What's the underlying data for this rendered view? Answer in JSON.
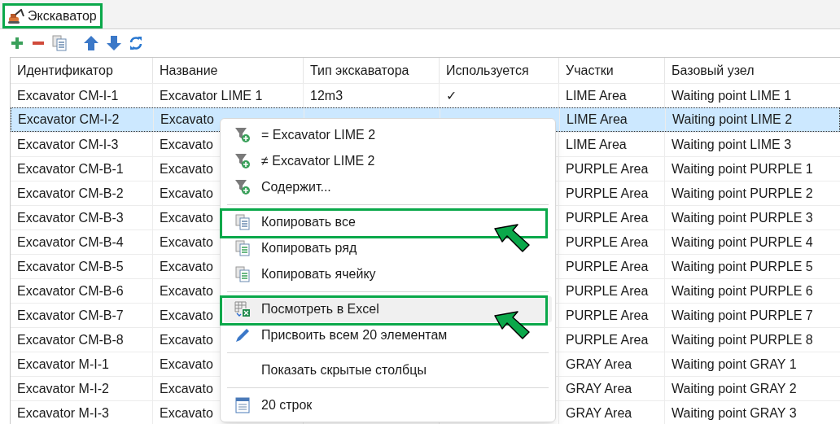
{
  "window": {
    "title": "Экскаватор",
    "title_highlighted": true
  },
  "table": {
    "columns": [
      "Идентификатор",
      "Название",
      "Тип экскаватора",
      "Используется",
      "Участки",
      "Базовый узел"
    ],
    "rows": [
      {
        "cells": [
          "Excavator CM-I-1",
          "Excavator LIME 1",
          "12m3",
          "✓",
          "LIME Area",
          "Waiting point LIME 1"
        ],
        "selected": false
      },
      {
        "cells": [
          "Excavator CM-I-2",
          "Excavato",
          null,
          null,
          "LIME Area",
          "Waiting point LIME 2"
        ],
        "selected": true
      },
      {
        "cells": [
          "Excavator CM-I-3",
          "Excavato",
          null,
          null,
          "LIME Area",
          "Waiting point LIME 3"
        ],
        "selected": false
      },
      {
        "cells": [
          "Excavator CM-B-1",
          "Excavato",
          null,
          null,
          "PURPLE Area",
          "Waiting point PURPLE 1"
        ],
        "selected": false
      },
      {
        "cells": [
          "Excavator CM-B-2",
          "Excavato",
          null,
          null,
          "PURPLE Area",
          "Waiting point PURPLE 2"
        ],
        "selected": false
      },
      {
        "cells": [
          "Excavator CM-B-3",
          "Excavato",
          null,
          null,
          "PURPLE Area",
          "Waiting point PURPLE 3"
        ],
        "selected": false
      },
      {
        "cells": [
          "Excavator CM-B-4",
          "Excavato",
          null,
          null,
          "PURPLE Area",
          "Waiting point PURPLE 4"
        ],
        "selected": false
      },
      {
        "cells": [
          "Excavator CM-B-5",
          "Excavato",
          null,
          null,
          "PURPLE Area",
          "Waiting point PURPLE 5"
        ],
        "selected": false
      },
      {
        "cells": [
          "Excavator CM-B-6",
          "Excavato",
          null,
          null,
          "PURPLE Area",
          "Waiting point PURPLE 6"
        ],
        "selected": false
      },
      {
        "cells": [
          "Excavator CM-B-7",
          "Excavato",
          null,
          null,
          "PURPLE Area",
          "Waiting point PURPLE 7"
        ],
        "selected": false
      },
      {
        "cells": [
          "Excavator CM-B-8",
          "Excavato",
          null,
          null,
          "PURPLE Area",
          "Waiting point PURPLE 8"
        ],
        "selected": false
      },
      {
        "cells": [
          "Excavator M-I-1",
          "Excavato",
          null,
          null,
          "GRAY Area",
          "Waiting point GRAY 1"
        ],
        "selected": false
      },
      {
        "cells": [
          "Excavator M-I-2",
          "Excavato",
          null,
          null,
          "GRAY Area",
          "Waiting point GRAY 2"
        ],
        "selected": false
      },
      {
        "cells": [
          "Excavator M-I-3",
          "Excavato",
          null,
          null,
          "GRAY Area",
          "Waiting point GRAY 3"
        ],
        "selected": false
      }
    ]
  },
  "context_menu": {
    "items": [
      {
        "kind": "item",
        "label": "= Excavator LIME 2",
        "hovered": false,
        "highlighted": false
      },
      {
        "kind": "item",
        "label": "≠ Excavator LIME 2",
        "hovered": false,
        "highlighted": false
      },
      {
        "kind": "item",
        "label": "Содержит...",
        "hovered": false,
        "highlighted": false
      },
      {
        "kind": "separator"
      },
      {
        "kind": "item",
        "label": "Копировать все",
        "hovered": false,
        "highlighted": true
      },
      {
        "kind": "item",
        "label": "Копировать ряд",
        "hovered": false,
        "highlighted": false
      },
      {
        "kind": "item",
        "label": "Копировать ячейку",
        "hovered": false,
        "highlighted": false
      },
      {
        "kind": "separator"
      },
      {
        "kind": "item",
        "label": "Посмотреть в Excel",
        "hovered": true,
        "highlighted": true
      },
      {
        "kind": "item",
        "label": "Присвоить всем 20 элементам",
        "hovered": false,
        "highlighted": false
      },
      {
        "kind": "separator"
      },
      {
        "kind": "item",
        "label": "Показать скрытые столбцы",
        "hovered": false,
        "highlighted": false
      },
      {
        "kind": "separator"
      },
      {
        "kind": "item",
        "label": "20 строк",
        "hovered": false,
        "highlighted": false
      }
    ]
  }
}
